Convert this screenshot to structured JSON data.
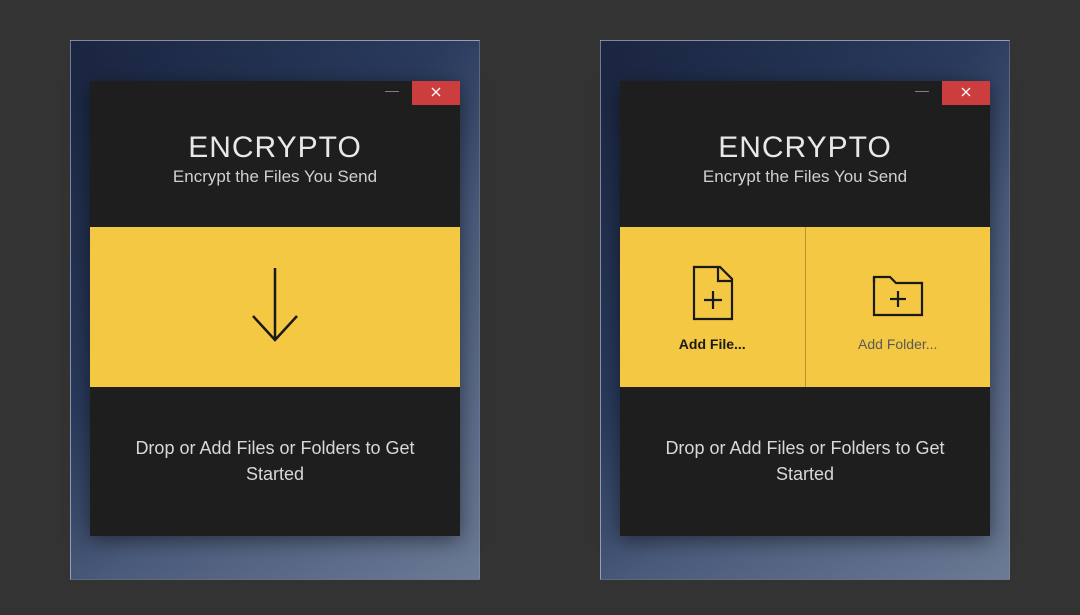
{
  "app": {
    "title": "ENCRYPTO",
    "subtitle": "Encrypt the Files You Send"
  },
  "footer": {
    "instruction": "Drop or Add Files or Folders to Get Started"
  },
  "add_controls": {
    "add_file_label": "Add File...",
    "add_folder_label": "Add Folder..."
  },
  "colors": {
    "accent_yellow": "#f4c842",
    "close_red": "#cc3d3d",
    "window_bg": "#1e1e1e"
  },
  "icons": {
    "close": "close-icon",
    "minimize": "minimize-icon",
    "arrow_down": "arrow-down-icon",
    "file_plus": "file-plus-icon",
    "folder_plus": "folder-plus-icon"
  }
}
